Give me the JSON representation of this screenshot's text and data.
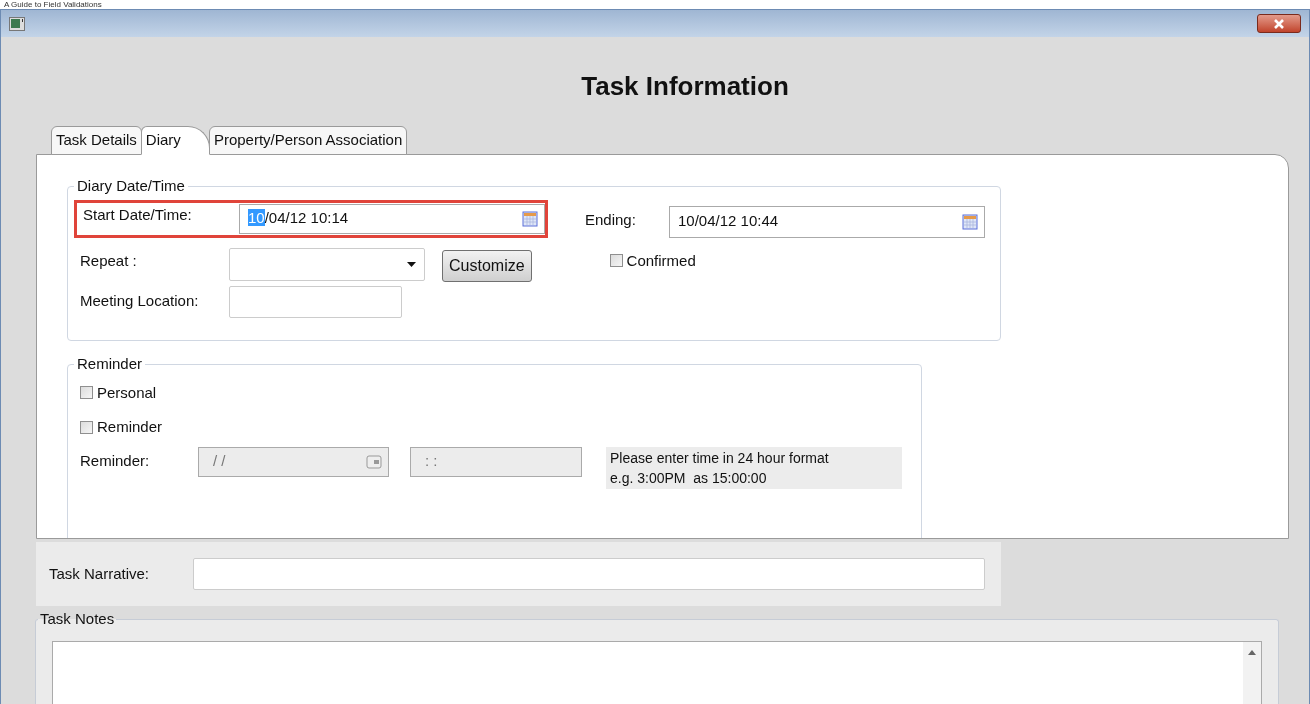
{
  "page_caption": "A Guide to Field Validations",
  "heading": "Task Information",
  "tabs": [
    {
      "label": "Task Details",
      "selected": false
    },
    {
      "label": "Diary",
      "selected": true
    },
    {
      "label": "Property/Person Association",
      "selected": false
    }
  ],
  "diary": {
    "legend": "Diary Date/Time",
    "start": {
      "label": "Start Date/Time:",
      "selected_text": "10",
      "value": "/04/12 10:14",
      "highlighted": true
    },
    "ending": {
      "label": "Ending:",
      "value": "10/04/12 10:44"
    },
    "repeat": {
      "label": "Repeat :"
    },
    "customize": "Customize",
    "confirmed": {
      "label": "Confirmed",
      "checked": false
    },
    "meeting_location": {
      "label": "Meeting Location:"
    }
  },
  "reminder": {
    "legend": "Reminder",
    "checkboxes": [
      {
        "label": "Personal",
        "checked": false
      },
      {
        "label": "Reminder",
        "checked": false
      }
    ],
    "label": "Reminder:",
    "date_value": "/ /",
    "time_value": ": :",
    "disabled": true,
    "hint_lines": [
      "Please enter time in 24 hour format",
      "e.g. 3:00PM  as 15:00:00"
    ]
  },
  "narrative": {
    "label": "Task Narrative:"
  },
  "notes": {
    "legend": "Task Notes"
  }
}
